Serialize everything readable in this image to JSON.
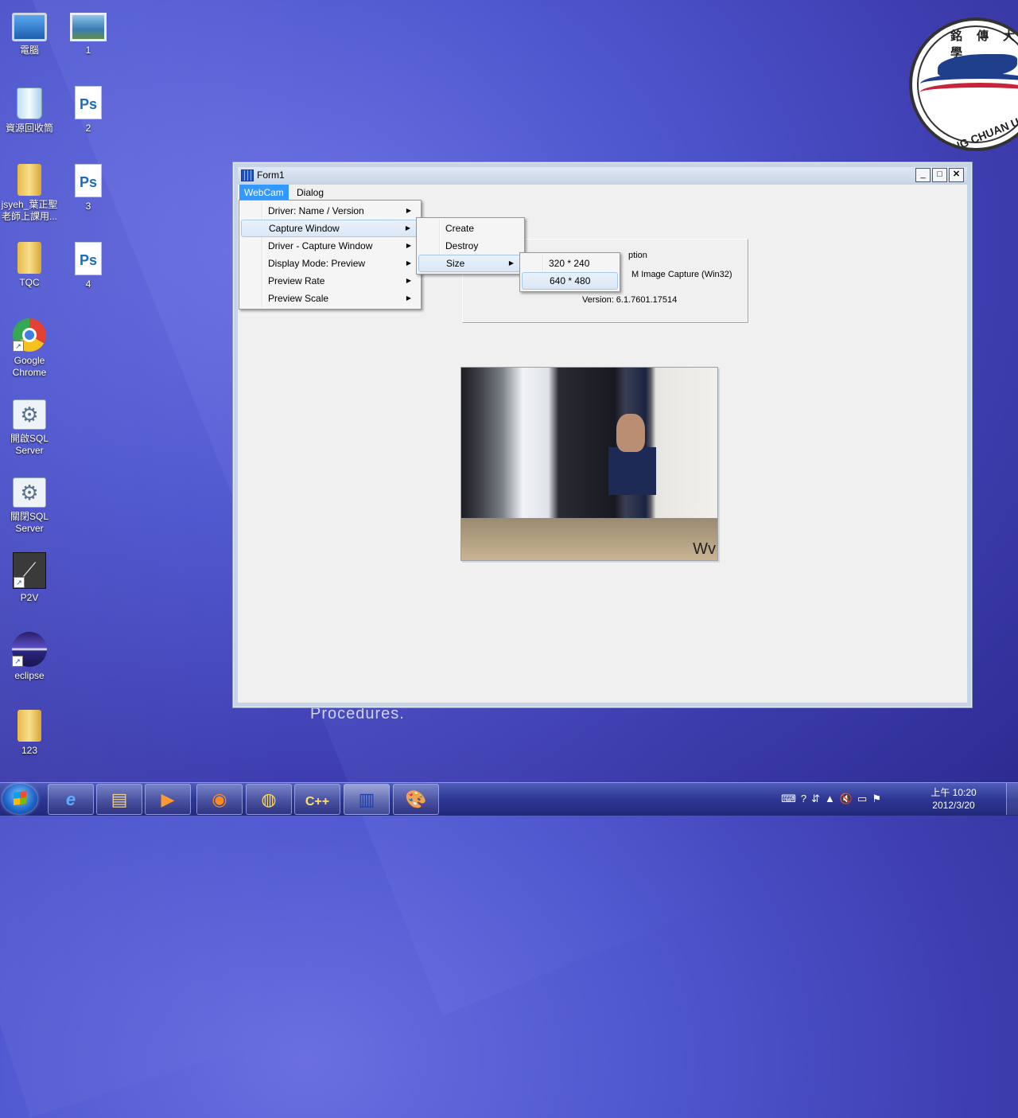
{
  "desktop": {
    "icons": [
      {
        "label": "電腦"
      },
      {
        "label": "1"
      },
      {
        "label": "資源回收筒"
      },
      {
        "label": "2"
      },
      {
        "label": "jsyeh_葉正聖老師上課用..."
      },
      {
        "label": "3"
      },
      {
        "label": "TQC"
      },
      {
        "label": "4"
      },
      {
        "label": "Google Chrome"
      },
      {
        "label": "開啟SQL Server"
      },
      {
        "label": "關閉SQL Server"
      },
      {
        "label": "P2V"
      },
      {
        "label": "eclipse"
      },
      {
        "label": "123"
      }
    ],
    "behind_text": "Procedures.",
    "logo": {
      "top_text": "銘傳大學",
      "ring_text": "MING CHUAN UNIVERSITY"
    }
  },
  "window": {
    "title": "Form1",
    "buttons": {
      "minimize": "_",
      "maximize": "□",
      "close": "✕"
    },
    "menubar": [
      "WebCam",
      "Dialog"
    ],
    "info": {
      "line1": "ption",
      "line2": "M Image Capture (Win32)",
      "version": "Version:  6.1.7601.17514"
    },
    "video_watermark": "Wv"
  },
  "menus": {
    "webcam_items": [
      "Driver: Name / Version",
      "Capture Window",
      "Driver - Capture Window",
      "Display Mode: Preview",
      "Preview Rate",
      "Preview Scale"
    ],
    "capture_window_items": [
      "Create",
      "Destroy",
      "Size"
    ],
    "size_items": [
      "320 * 240",
      "640 * 480"
    ]
  },
  "taskbar": {
    "clock_time": "上午 10:20",
    "clock_date": "2012/3/20"
  }
}
